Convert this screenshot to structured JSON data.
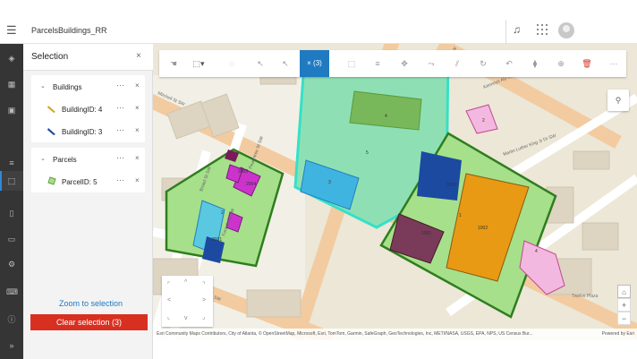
{
  "app": {
    "title": "ParcelsBuildings_RR"
  },
  "panel": {
    "title": "Selection",
    "groups": [
      {
        "name": "Buildings",
        "items": [
          {
            "label": "BuildingID: 4"
          },
          {
            "label": "BuildingID: 3"
          }
        ]
      },
      {
        "name": "Parcels",
        "items": [
          {
            "label": "ParcelID: 5"
          }
        ]
      }
    ],
    "more_label": "···",
    "close_label": "×",
    "zoom_to_selection": "Zoom to selection",
    "clear_selection": "Clear selection (3)"
  },
  "toolbar": {
    "selection_count": "× (3)"
  },
  "map": {
    "attribution": "Esri Community Maps Contributors, City of Atlanta, © OpenStreetMap, Microsoft, Esri, TomTom, Garmin, SafeGraph, GeoTechnologies, Inc, METI/NASA, USGS, EPA, NPS, US Census Bur...",
    "powered_by": "Powered by Esri",
    "streets": [
      "Mitchell St SW",
      "Trinity Ave SW",
      "Peachtree St SW",
      "Forsyth St SW",
      "Broad St SW",
      "Pryor St SW",
      "Martin Luther King Jr Dr SW",
      "Kenneys Aly SW",
      "Pryor St SW",
      "Trinity Ave SW"
    ],
    "place": "Twelve Plaza",
    "feature_labels": [
      "4",
      "5",
      "3",
      "2",
      "1000",
      "1",
      "1001",
      "1002",
      "4",
      "2",
      "2001",
      "2003",
      "2004"
    ],
    "colors": {
      "selection": "#1f7ac1",
      "clear": "#d83020",
      "parcel_green": "#2f7d1f",
      "highlight_cyan": "#36e0c8"
    }
  },
  "icons": [
    "menu-icon",
    "bell-icon",
    "apps-grid-icon",
    "avatar",
    "layers-icon",
    "table-icon",
    "widgets-icon",
    "selection-icon",
    "list-icon",
    "bookmark-icon",
    "folder-icon",
    "settings-icon",
    "keyboard-icon",
    "info-icon",
    "expand-icon",
    "pan-icon",
    "select-rect-icon",
    "lasso-icon",
    "add-select-icon",
    "remove-select-icon",
    "search-icon",
    "home-icon",
    "delete-icon"
  ]
}
